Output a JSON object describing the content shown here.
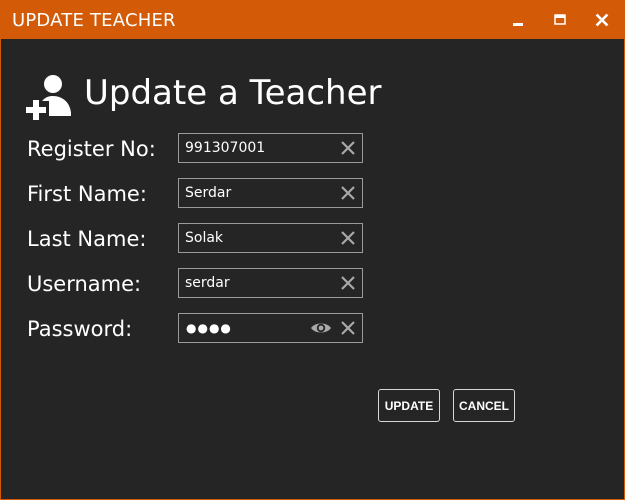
{
  "window": {
    "title": "UPDATE TEACHER",
    "accent_color": "#d35b08",
    "background_color": "#252525"
  },
  "titlebar_buttons": [
    {
      "name": "minimize",
      "icon": "minimize-icon"
    },
    {
      "name": "maximize",
      "icon": "maximize-icon"
    },
    {
      "name": "close",
      "icon": "close-icon"
    }
  ],
  "header": {
    "icon": "add-user-icon",
    "title": "Update a Teacher"
  },
  "form": {
    "register_no": {
      "label": "Register No:",
      "value": "991307001"
    },
    "first_name": {
      "label": "First Name:",
      "value": "Serdar"
    },
    "last_name": {
      "label": "Last Name:",
      "value": "Solak"
    },
    "username": {
      "label": "Username:",
      "value": "serdar"
    },
    "password": {
      "label": "Password:",
      "masked_value": "●●●●",
      "reveal_icon": "eye-icon"
    },
    "clear_icon": "clear-icon"
  },
  "actions": {
    "update_label": "UPDATE",
    "cancel_label": "CANCEL"
  }
}
